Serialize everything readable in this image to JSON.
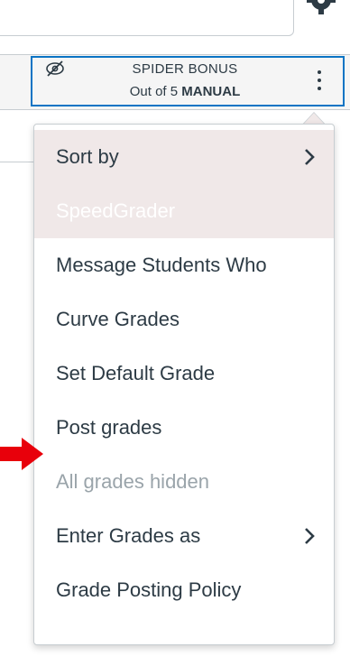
{
  "column_header": {
    "title": "SPIDER BONUS",
    "subtitle_prefix": "Out of 5",
    "subtitle_mode": "MANUAL",
    "hidden_icon": "eye-slash-icon",
    "options_icon": "kebab-menu-icon"
  },
  "menu": {
    "items": [
      {
        "label": "Sort by",
        "has_submenu": true
      },
      {
        "label": "SpeedGrader"
      },
      {
        "label": "Message Students Who"
      },
      {
        "label": "Curve Grades"
      },
      {
        "label": "Set Default Grade"
      },
      {
        "label": "Post grades"
      },
      {
        "label": "All grades hidden",
        "disabled": true
      },
      {
        "label": "Enter Grades as",
        "has_submenu": true
      },
      {
        "label": "Grade Posting Policy"
      }
    ]
  },
  "annotation": {
    "arrow_color": "#e8000b",
    "points_to": "Post grades"
  },
  "colors": {
    "focus_border": "#0b74c4",
    "highlight_bg": "#f0e8e8",
    "text": "#2d3b45",
    "disabled_text": "#9aa4aa"
  }
}
